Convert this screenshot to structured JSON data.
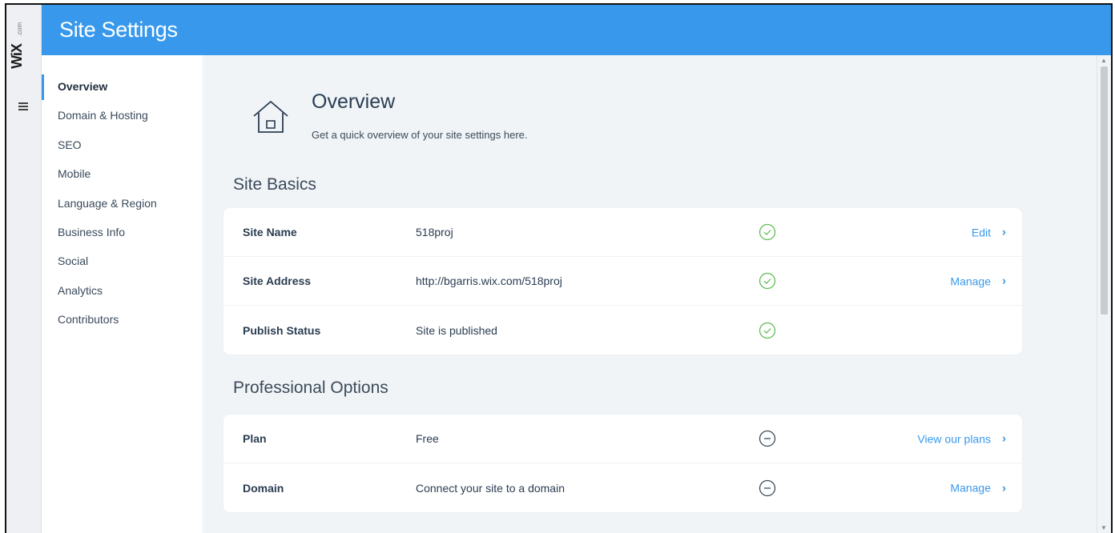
{
  "brand": {
    "logo_text": "WiX",
    "logo_suffix": ".com"
  },
  "header": {
    "title": "Site Settings"
  },
  "sidebar": {
    "items": [
      {
        "label": "Overview",
        "active": true
      },
      {
        "label": "Domain & Hosting"
      },
      {
        "label": "SEO"
      },
      {
        "label": "Mobile"
      },
      {
        "label": "Language & Region"
      },
      {
        "label": "Business Info"
      },
      {
        "label": "Social"
      },
      {
        "label": "Analytics"
      },
      {
        "label": "Contributors"
      }
    ]
  },
  "overview": {
    "title": "Overview",
    "subtitle": "Get a quick overview of your site settings here."
  },
  "site_basics": {
    "title": "Site Basics",
    "rows": [
      {
        "label": "Site Name",
        "value": "518proj",
        "status": "check",
        "action": "Edit"
      },
      {
        "label": "Site Address",
        "value": "http://bgarris.wix.com/518proj",
        "status": "check",
        "action": "Manage"
      },
      {
        "label": "Publish Status",
        "value": "Site is published",
        "status": "check",
        "action": ""
      }
    ]
  },
  "professional_options": {
    "title": "Professional Options",
    "rows": [
      {
        "label": "Plan",
        "value": "Free",
        "status": "minus",
        "action": "View our plans"
      },
      {
        "label": "Domain",
        "value": "Connect your site to a domain",
        "status": "minus",
        "action": "Manage"
      }
    ]
  },
  "colors": {
    "accent": "#3899ec",
    "success": "#60bc57",
    "neutral": "#3d4b5a"
  }
}
